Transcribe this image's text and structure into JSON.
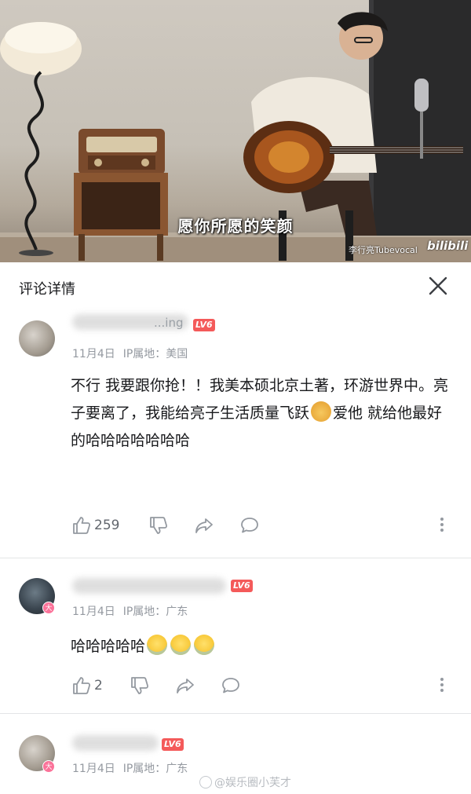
{
  "video": {
    "subtitle": "愿你所愿的笑颜",
    "credit": "李行亮Tubevocal",
    "platform_logo": "bilibili"
  },
  "header": {
    "title": "评论详情",
    "close_icon": "close-icon"
  },
  "comments": [
    {
      "username": "...ing",
      "level": "LV6",
      "date": "11月4日",
      "ip": "IP属地：美国",
      "text_parts": [
        "不行 我要跟你抢！！我美本硕北京土著，环游世界中。亮子要离了，我能给亮子生活质量飞跃",
        "爱他 就给他最好的哈哈哈哈哈哈哈"
      ],
      "emoji": "doge-emoji",
      "likes": "259"
    },
    {
      "username": "",
      "level": "LV6",
      "badge": "大",
      "date": "11月4日",
      "ip": "IP属地：广东",
      "text": "哈哈哈哈哈",
      "emoji": "laugh-cry-emoji",
      "likes": "2"
    },
    {
      "username": "",
      "level": "LV6",
      "badge": "大",
      "date": "11月4日",
      "ip": "IP属地：广东"
    }
  ],
  "watermark": "@娱乐圈小芙才",
  "colors": {
    "level_badge": "#f45a5a",
    "meta_text": "#9499a0",
    "badge_pink": "#fb7299"
  }
}
